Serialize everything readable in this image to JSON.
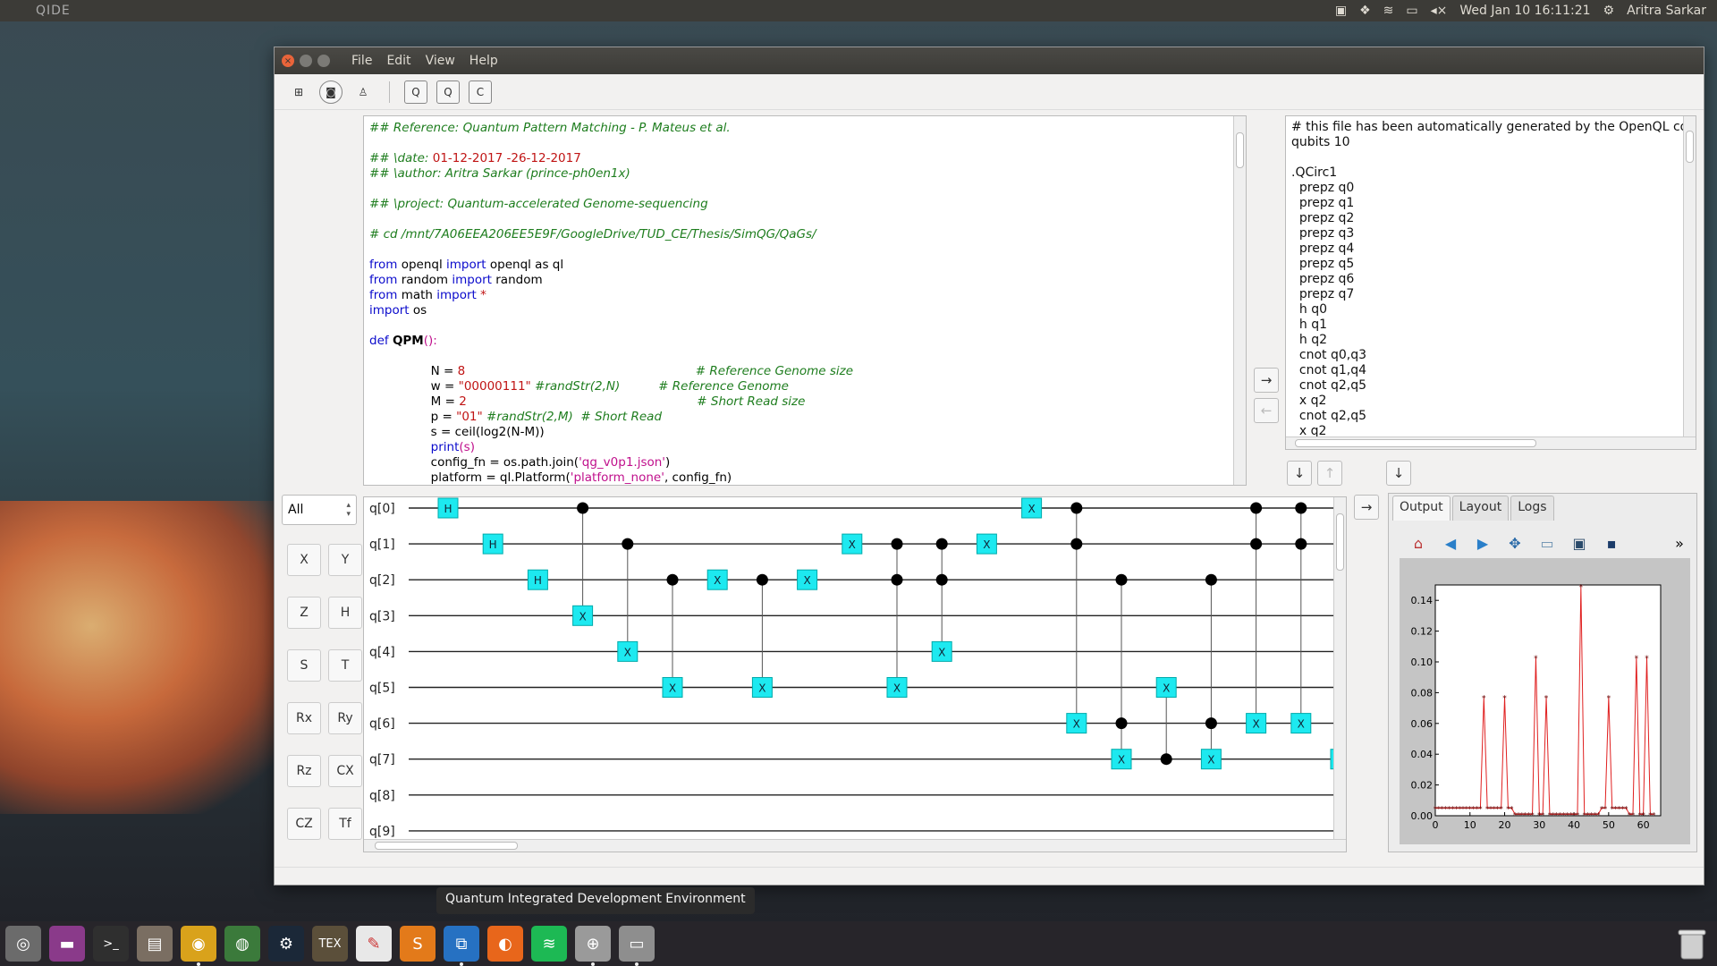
{
  "panel": {
    "app_name": "QIDE",
    "datetime": "Wed Jan 10 16:11:21",
    "user": "Aritra Sarkar"
  },
  "window": {
    "menu": [
      "File",
      "Edit",
      "View",
      "Help"
    ],
    "toolbar_letter_buttons": [
      "Q",
      "Q",
      "C"
    ]
  },
  "editor": {
    "lines": [
      [
        {
          "t": "## Reference: Quantum Pattern Matching - P. Mateus et al.",
          "c": "c-comment"
        }
      ],
      [],
      [
        {
          "t": "## \\date: ",
          "c": "c-comment"
        },
        {
          "t": "01-12-2017 -26-12-2017",
          "c": "c-num"
        }
      ],
      [
        {
          "t": "## \\author: Aritra Sarkar (prince-ph0en1x)",
          "c": "c-comment"
        }
      ],
      [],
      [
        {
          "t": "## \\project: Quantum-accelerated Genome-sequencing",
          "c": "c-comment"
        }
      ],
      [],
      [
        {
          "t": "# cd /mnt/7A06EEA206EE5E9F/GoogleDrive/TUD_CE/Thesis/SimQG/QaGs/",
          "c": "c-comment"
        }
      ],
      [],
      [
        {
          "t": "from",
          "c": "c-kw"
        },
        {
          "t": " openql "
        },
        {
          "t": "import",
          "c": "c-kw"
        },
        {
          "t": " openql as ql"
        }
      ],
      [
        {
          "t": "from",
          "c": "c-kw"
        },
        {
          "t": " random "
        },
        {
          "t": "import",
          "c": "c-kw"
        },
        {
          "t": " random"
        }
      ],
      [
        {
          "t": "from",
          "c": "c-kw"
        },
        {
          "t": " math "
        },
        {
          "t": "import",
          "c": "c-kw"
        },
        {
          "t": " *",
          "c": "c-num"
        }
      ],
      [
        {
          "t": "import",
          "c": "c-kw"
        },
        {
          "t": " os"
        }
      ],
      [],
      [
        {
          "t": "def",
          "c": "c-def"
        },
        {
          "t": " "
        },
        {
          "t": "QPM",
          "c": "c-fn"
        },
        {
          "t": "():",
          "c": "c-str"
        }
      ],
      [],
      [
        {
          "t": "                N = "
        },
        {
          "t": "8",
          "c": "c-num"
        },
        {
          "t": "                                                            "
        },
        {
          "t": "# Reference Genome size",
          "c": "c-comment"
        }
      ],
      [
        {
          "t": "                w = "
        },
        {
          "t": "\"00000111\"",
          "c": "c-num"
        },
        {
          "t": " "
        },
        {
          "t": "#randStr(2,N)",
          "c": "c-comment"
        },
        {
          "t": "          "
        },
        {
          "t": "# Reference Genome",
          "c": "c-comment"
        }
      ],
      [
        {
          "t": "                M = "
        },
        {
          "t": "2",
          "c": "c-num"
        },
        {
          "t": "                                                            "
        },
        {
          "t": "# Short Read size",
          "c": "c-comment"
        }
      ],
      [
        {
          "t": "                p = "
        },
        {
          "t": "\"01\"",
          "c": "c-num"
        },
        {
          "t": " "
        },
        {
          "t": "#randStr(2,M)",
          "c": "c-comment"
        },
        {
          "t": "  "
        },
        {
          "t": "# Short Read",
          "c": "c-comment"
        }
      ],
      [
        {
          "t": "                s = ceil(log2(N-M))"
        }
      ],
      [
        {
          "t": "                "
        },
        {
          "t": "print",
          "c": "c-kw"
        },
        {
          "t": "(s)",
          "c": "c-str"
        }
      ],
      [
        {
          "t": "                config_fn = os.path.join("
        },
        {
          "t": "'qg_v0p1.json'",
          "c": "c-str"
        },
        {
          "t": ")"
        }
      ],
      [
        {
          "t": "                platform = ql.Platform("
        },
        {
          "t": "'platform_none'",
          "c": "c-str"
        },
        {
          "t": ", config_fn)"
        }
      ]
    ]
  },
  "qasm": {
    "lines": [
      "# this file has been automatically generated by the OpenQL compiler",
      "qubits 10",
      "",
      ".QCirc1",
      "  prepz q0",
      "  prepz q1",
      "  prepz q2",
      "  prepz q3",
      "  prepz q4",
      "  prepz q5",
      "  prepz q6",
      "  prepz q7",
      "  h q0",
      "  h q1",
      "  h q2",
      "  cnot q0,q3",
      "  cnot q1,q4",
      "  cnot q2,q5",
      "  x q2",
      "  cnot q2,q5",
      "  x q2"
    ]
  },
  "arrows": {
    "right": "→",
    "left": "←",
    "down": "↓",
    "up": "↑"
  },
  "palette": {
    "filter": "All",
    "gates": [
      "X",
      "Y",
      "Z",
      "H",
      "S",
      "T",
      "Rx",
      "Ry",
      "Rz",
      "CX",
      "CZ",
      "Tf"
    ]
  },
  "circuit": {
    "qubits": [
      "q[0]",
      "q[1]",
      "q[2]",
      "q[3]",
      "q[4]",
      "q[5]",
      "q[6]",
      "q[7]",
      "q[8]",
      "q[9]"
    ],
    "gate_color": "#1de9f0",
    "ops": [
      {
        "type": "H",
        "q": 0
      },
      {
        "type": "H",
        "q": 1
      },
      {
        "type": "H",
        "q": 2
      },
      {
        "type": "CX",
        "c": [
          0
        ],
        "t": 3
      },
      {
        "type": "CX",
        "c": [
          1
        ],
        "t": 4
      },
      {
        "type": "CX",
        "c": [
          2
        ],
        "t": 5
      },
      {
        "type": "X",
        "q": 2
      },
      {
        "type": "CX",
        "c": [
          2
        ],
        "t": 5
      },
      {
        "type": "X",
        "q": 2
      },
      {
        "type": "X",
        "q": 1
      },
      {
        "type": "CX",
        "c": [
          1,
          2
        ],
        "t": 5
      },
      {
        "type": "CX",
        "c": [
          1,
          2
        ],
        "t": 4
      },
      {
        "type": "X",
        "q": 1
      },
      {
        "type": "X",
        "q": 0
      },
      {
        "type": "CX",
        "c": [
          0,
          1
        ],
        "t": 6
      },
      {
        "type": "CX",
        "c": [
          2,
          6
        ],
        "t": 7
      },
      {
        "type": "CX",
        "c": [
          7
        ],
        "t": 5
      },
      {
        "type": "CX",
        "c": [
          2,
          6
        ],
        "t": 7
      },
      {
        "type": "CX",
        "c": [
          0,
          1
        ],
        "t": 6
      },
      {
        "type": "CX",
        "c": [
          0,
          1
        ],
        "t": 6
      }
    ]
  },
  "plot_panel": {
    "tabs": [
      "Output",
      "Layout",
      "Logs"
    ],
    "active_tab": "Output",
    "more": "»"
  },
  "chart_data": {
    "type": "line",
    "x": [
      0,
      1,
      2,
      3,
      4,
      5,
      6,
      7,
      8,
      9,
      10,
      11,
      12,
      13,
      14,
      15,
      16,
      17,
      18,
      19,
      20,
      21,
      22,
      23,
      24,
      25,
      26,
      27,
      28,
      29,
      30,
      31,
      32,
      33,
      34,
      35,
      36,
      37,
      38,
      39,
      40,
      41,
      42,
      43,
      44,
      45,
      46,
      47,
      48,
      49,
      50,
      51,
      52,
      53,
      54,
      55,
      56,
      57,
      58,
      59,
      60,
      61,
      62,
      63
    ],
    "values": [
      0.005,
      0.005,
      0.005,
      0.005,
      0.005,
      0.005,
      0.005,
      0.005,
      0.005,
      0.005,
      0.005,
      0.005,
      0.005,
      0.005,
      0.077,
      0.005,
      0.005,
      0.005,
      0.005,
      0.005,
      0.077,
      0.005,
      0.005,
      0.001,
      0.001,
      0.001,
      0.001,
      0.001,
      0.001,
      0.103,
      0.001,
      0.001,
      0.077,
      0.001,
      0.001,
      0.001,
      0.001,
      0.001,
      0.001,
      0.001,
      0.001,
      0.001,
      0.149,
      0.001,
      0.001,
      0.001,
      0.001,
      0.001,
      0.005,
      0.005,
      0.077,
      0.005,
      0.005,
      0.005,
      0.005,
      0.005,
      0.001,
      0.001,
      0.103,
      0.001,
      0.001,
      0.103,
      0.001,
      0.001
    ],
    "ylim": [
      0,
      0.15
    ],
    "xlim": [
      0,
      65
    ],
    "xticks": [
      "0",
      "10",
      "20",
      "30",
      "40",
      "50",
      "60"
    ],
    "yticks": [
      "0.00",
      "0.02",
      "0.04",
      "0.06",
      "0.08",
      "0.10",
      "0.12",
      "0.14"
    ],
    "line_color": "#e02020",
    "marker": "*"
  },
  "launcher": {
    "tooltip": "Quantum Integrated Development Environment",
    "apps": [
      {
        "name": "ubuntu-dash",
        "glyph": "◎",
        "bg": "#6b6b6b"
      },
      {
        "name": "screen",
        "glyph": "▬",
        "bg": "#8a3a8a"
      },
      {
        "name": "terminal",
        "glyph": ">_",
        "bg": "#2f2f2f"
      },
      {
        "name": "files",
        "glyph": "▤",
        "bg": "#7a6e62"
      },
      {
        "name": "chrome",
        "glyph": "◉",
        "bg": "#d9a21b"
      },
      {
        "name": "globe",
        "glyph": "◍",
        "bg": "#3b7a3b"
      },
      {
        "name": "steam",
        "glyph": "⚙",
        "bg": "#1b2838"
      },
      {
        "name": "tex",
        "glyph": "TEX",
        "bg": "#5b4f3a"
      },
      {
        "name": "pdf",
        "glyph": "✎",
        "bg": "#e8e8e8"
      },
      {
        "name": "sublime",
        "glyph": "S",
        "bg": "#e37a1a"
      },
      {
        "name": "vscode",
        "glyph": "⧉",
        "bg": "#2671c2"
      },
      {
        "name": "firefox",
        "glyph": "◐",
        "bg": "#e8661b"
      },
      {
        "name": "spotify",
        "glyph": "≋",
        "bg": "#1db954"
      },
      {
        "name": "qide",
        "glyph": "⊕",
        "bg": "#9a9a9a"
      },
      {
        "name": "drive",
        "glyph": "▭",
        "bg": "#8e8e8e"
      }
    ]
  }
}
